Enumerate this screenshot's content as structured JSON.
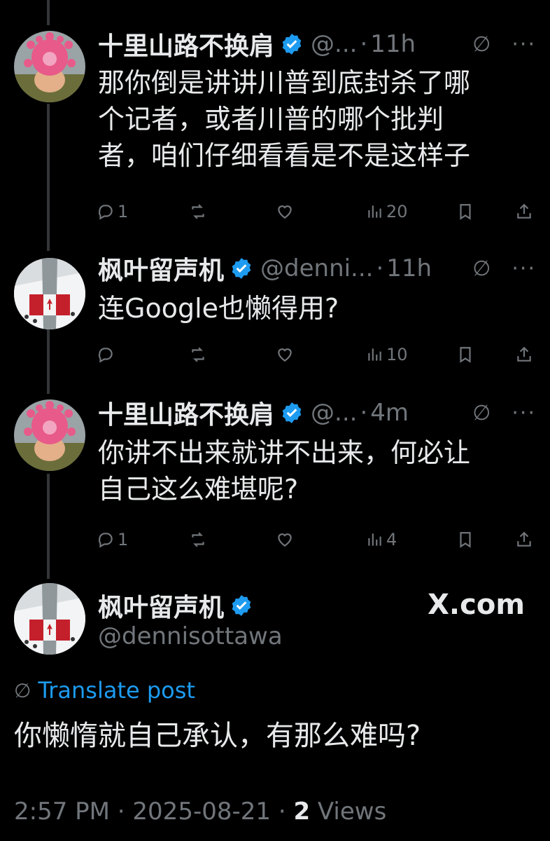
{
  "thread": [
    {
      "name": "十里山路不换肩",
      "handle": "@...",
      "time": "11h",
      "text_lines": [
        "那你倒是讲讲川普到底封杀了哪",
        "个记者，或者川普的哪个批判",
        "者，咱们仔细看看是不是这样子"
      ],
      "replies": "1",
      "reposts": "",
      "likes": "",
      "views": "20",
      "avatar_icon": "coronavirus-head-avatar"
    },
    {
      "name": "枫叶留声机",
      "handle": "@denni...",
      "time": "11h",
      "text_lines": [
        "连Google也懒得用?"
      ],
      "replies": "",
      "reposts": "",
      "likes": "",
      "views": "10",
      "avatar_icon": "canada-flag-crowd-avatar"
    },
    {
      "name": "十里山路不换肩",
      "handle": "@...",
      "time": "4m",
      "text_lines": [
        "你讲不出来就讲不出来，何必让",
        "自己这么难堪呢?"
      ],
      "replies": "1",
      "reposts": "",
      "likes": "",
      "views": "4",
      "avatar_icon": "coronavirus-head-avatar"
    }
  ],
  "main_post": {
    "name": "枫叶留声机",
    "handle": "@dennisottawa",
    "watermark": "X.com",
    "translate_label": "Translate post",
    "text": "你懒惰就自己承认，有那么难吗?",
    "timestamp": "2:57 PM · 2025-08-21 · ",
    "views_count": "2",
    "views_label": " Views"
  },
  "separator_dot": "·",
  "icons": {
    "verified": "verified-badge-icon",
    "grok": "grok-icon",
    "more": "more-icon",
    "reply": "reply-icon",
    "repost": "repost-icon",
    "like": "like-icon",
    "views": "views-icon",
    "bookmark": "bookmark-icon",
    "share": "share-icon"
  },
  "colors": {
    "background": "#000000",
    "text": "#e7e9ea",
    "muted": "#71767b",
    "accent": "#1d9bf0"
  }
}
